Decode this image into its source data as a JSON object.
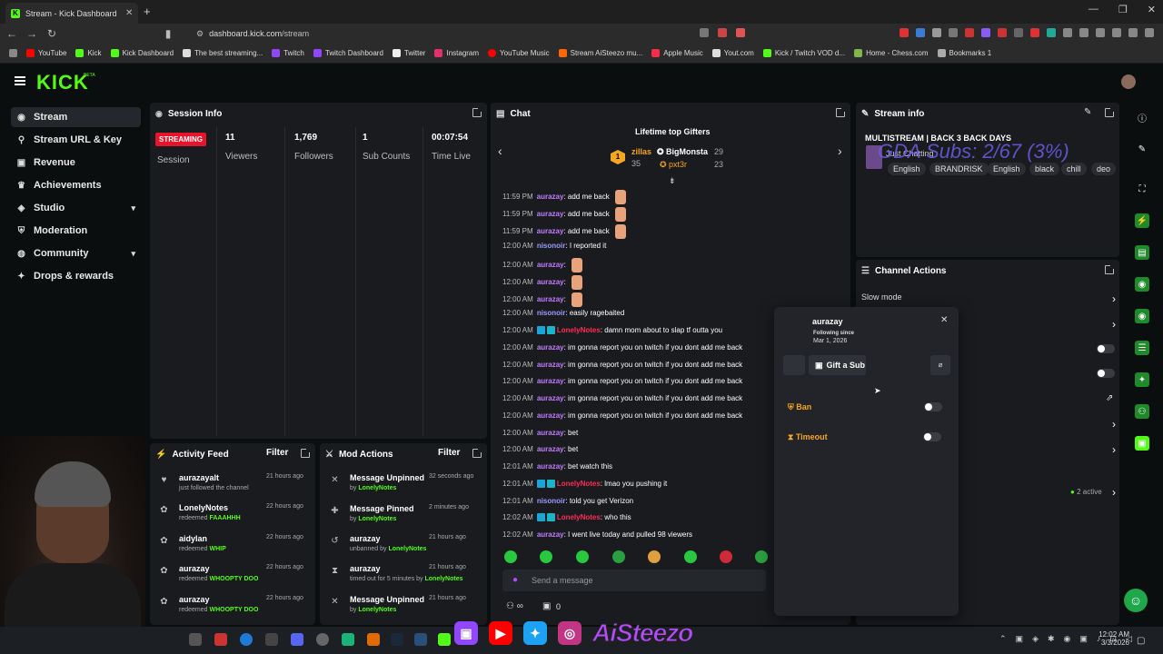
{
  "browser": {
    "tab_title": "Stream - Kick Dashboard",
    "url_host": "dashboard.kick.com",
    "url_path": "/stream",
    "bookmarks": [
      "YouTube",
      "Kick",
      "Kick Dashboard",
      "The best streaming...",
      "Twitch",
      "Twitch Dashboard",
      "Twitter",
      "Instagram",
      "YouTube Music",
      "Stream AiSteezo mu...",
      "Apple Music",
      "Yout.com",
      "Kick / Twitch VOD d...",
      "Home - Chess.com",
      "Bookmarks 1"
    ]
  },
  "header": {
    "logo": "KICK",
    "beta": "BETA"
  },
  "sidebar": {
    "items": [
      {
        "label": "Stream",
        "icon": "broadcast-icon"
      },
      {
        "label": "Stream URL & Key",
        "icon": "key-icon"
      },
      {
        "label": "Revenue",
        "icon": "revenue-icon"
      },
      {
        "label": "Achievements",
        "icon": "trophy-icon"
      },
      {
        "label": "Studio",
        "icon": "studio-icon",
        "chev": "▾"
      },
      {
        "label": "Moderation",
        "icon": "shield-icon"
      },
      {
        "label": "Community",
        "icon": "globe-icon",
        "chev": "▾"
      },
      {
        "label": "Drops & rewards",
        "icon": "gift-icon"
      }
    ]
  },
  "session": {
    "title": "Session Info",
    "status": "STREAMING",
    "session_label": "Session",
    "viewers": "11",
    "viewers_label": "Viewers",
    "followers": "1,769",
    "followers_label": "Followers",
    "subs": "1",
    "subs_label": "Sub Counts",
    "time": "00:07:54",
    "time_label": "Time Live"
  },
  "activity": {
    "title": "Activity Feed",
    "filter": "Filter",
    "items": [
      {
        "name": "aurazayalt",
        "sub": "just followed the channel",
        "hl": "",
        "time": "21 hours ago"
      },
      {
        "name": "LonelyNotes",
        "sub": "redeemed",
        "hl": "FAAAHHH",
        "time": "22 hours ago"
      },
      {
        "name": "aidylan",
        "sub": "redeemed",
        "hl": "WHIP",
        "time": "22 hours ago"
      },
      {
        "name": "aurazay",
        "sub": "redeemed",
        "hl": "WHOOPTY DOO",
        "time": "22 hours ago"
      },
      {
        "name": "aurazay",
        "sub": "redeemed",
        "hl": "WHOOPTY DOO",
        "time": "22 hours ago"
      }
    ]
  },
  "mod": {
    "title": "Mod Actions",
    "filter": "Filter",
    "items": [
      {
        "name": "Message Unpinned",
        "pre": "by",
        "who": "LonelyNotes",
        "time": "32 seconds ago"
      },
      {
        "name": "Message Pinned",
        "pre": "by",
        "who": "LonelyNotes",
        "time": "2 minutes ago"
      },
      {
        "name": "aurazay",
        "pre": "unbanned by",
        "who": "LonelyNotes",
        "time": "21 hours ago"
      },
      {
        "name": "aurazay",
        "pre": "timed out for 5 minutes by",
        "who": "LonelyNotes",
        "time": "21 hours ago"
      },
      {
        "name": "Message Unpinned",
        "pre": "by",
        "who": "LonelyNotes",
        "time": "21 hours ago"
      }
    ]
  },
  "chat": {
    "title": "Chat",
    "gifters_title": "Lifetime top Gifters",
    "gifter1": "zillas",
    "gifter1_count": "35",
    "gifter2": "BigMonsta",
    "gifter2_count": "29",
    "gifter3": "pxt3r",
    "gifter3_count": "23",
    "messages": [
      {
        "time": "11:59 PM",
        "user": "aurazay",
        "text": ": add me back",
        "hand": true
      },
      {
        "time": "11:59 PM",
        "user": "aurazay",
        "text": ": add me back",
        "hand": true
      },
      {
        "time": "11:59 PM",
        "user": "aurazay",
        "text": ": add me back",
        "hand": true
      },
      {
        "time": "12:00 AM",
        "user": "nisonoir",
        "text": ": I reported it"
      },
      {
        "time": "12:00 AM",
        "user": "aurazay",
        "text": ":",
        "hand": true
      },
      {
        "time": "12:00 AM",
        "user": "aurazay",
        "text": ":",
        "hand": true
      },
      {
        "time": "12:00 AM",
        "user": "aurazay",
        "text": ":",
        "hand": true
      },
      {
        "time": "12:00 AM",
        "user": "nisonoir",
        "text": ": easily ragebaited"
      },
      {
        "time": "12:00 AM",
        "user": "LonelyNotes",
        "text": ": damn mom about to slap tf outta you",
        "badges": true
      },
      {
        "time": "12:00 AM",
        "user": "aurazay",
        "text": ": im gonna report you on twitch if you dont add me back"
      },
      {
        "time": "12:00 AM",
        "user": "aurazay",
        "text": ": im gonna report you on twitch if you dont add me back"
      },
      {
        "time": "12:00 AM",
        "user": "aurazay",
        "text": ": im gonna report you on twitch if you dont add me back"
      },
      {
        "time": "12:00 AM",
        "user": "aurazay",
        "text": ": im gonna report you on twitch if you dont add me back"
      },
      {
        "time": "12:00 AM",
        "user": "aurazay",
        "text": ": im gonna report you on twitch if you dont add me back"
      },
      {
        "time": "12:00 AM",
        "user": "aurazay",
        "text": ": bet"
      },
      {
        "time": "12:00 AM",
        "user": "aurazay",
        "text": ": bet"
      },
      {
        "time": "12:01 AM",
        "user": "aurazay",
        "text": ": bet watch this"
      },
      {
        "time": "12:01 AM",
        "user": "LonelyNotes",
        "text": ": lmao you pushing it",
        "badges": true
      },
      {
        "time": "12:01 AM",
        "user": "nisonoir",
        "text": ": told you get Verizon"
      },
      {
        "time": "12:02 AM",
        "user": "LonelyNotes",
        "text": ": who this",
        "badges": true
      },
      {
        "time": "12:02 AM",
        "user": "aurazay",
        "text": ": I went live today and pulled 98 viewers"
      }
    ],
    "placeholder": "Send a message",
    "count": "0"
  },
  "stream_info": {
    "title": "Stream info",
    "stream_title": "MULTISTREAM | BACK 3 BACK DAYS",
    "category": "Just Chatting",
    "tags": [
      "English",
      "BRANDRISK",
      "English",
      "black",
      "chill",
      "deo"
    ],
    "overlay": "GDA Subs: 2/67 (3%)"
  },
  "channel_actions": {
    "title": "Channel Actions",
    "slow_mode": "Slow mode",
    "active": "2 active"
  },
  "user_card": {
    "username": "aurazay",
    "following_label": "Following since",
    "following_date": "Mar 1, 2026",
    "gift": "Gift a Sub",
    "ban": "Ban",
    "timeout": "Timeout"
  },
  "overlay_brand": {
    "handle": "AiSteezo"
  },
  "clock": {
    "time": "12:02 AM",
    "date": "3/3/2026"
  },
  "colors": {
    "accent": "#53fc18",
    "streaming": "#e5152c",
    "panel": "#191b1f"
  }
}
